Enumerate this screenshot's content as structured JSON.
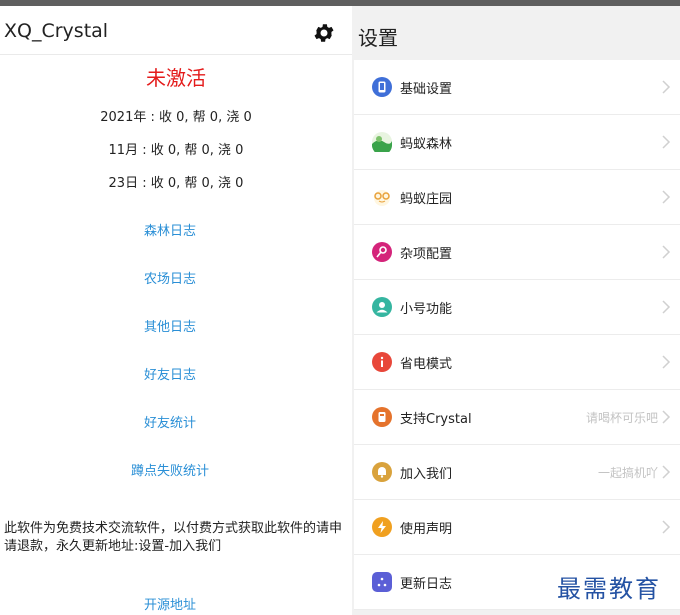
{
  "left": {
    "app_title": "XQ_Crystal",
    "status": "未激活",
    "stats": [
      "2021年 : 收 0,  帮 0,  浇 0",
      "11月 : 收 0,  帮 0,  浇 0",
      "23日 : 收 0,  帮 0,  浇 0"
    ],
    "links": [
      "森林日志",
      "农场日志",
      "其他日志",
      "好友日志",
      "好友统计",
      "蹲点失败统计"
    ],
    "notice": "此软件为免费技术交流软件，以付费方式获取此软件的请申请退款，永久更新地址:设置-加入我们",
    "open_source": "开源地址"
  },
  "right": {
    "title": "设置",
    "items": [
      {
        "label": "基础设置",
        "hint": "",
        "icon": "phone-icon"
      },
      {
        "label": "蚂蚁森林",
        "hint": "",
        "icon": "forest-icon"
      },
      {
        "label": "蚂蚁庄园",
        "hint": "",
        "icon": "farm-icon"
      },
      {
        "label": "杂项配置",
        "hint": "",
        "icon": "key-icon"
      },
      {
        "label": "小号功能",
        "hint": "",
        "icon": "user-icon"
      },
      {
        "label": "省电模式",
        "hint": "",
        "icon": "info-icon"
      },
      {
        "label": "支持Crystal",
        "hint": "请喝杯可乐吧",
        "icon": "cup-icon"
      },
      {
        "label": "加入我们",
        "hint": "一起搞机吖",
        "icon": "bell-icon"
      },
      {
        "label": "使用声明",
        "hint": "",
        "icon": "bolt-icon"
      },
      {
        "label": "更新日志",
        "hint": "",
        "icon": "dots-icon"
      }
    ]
  },
  "watermark": "最需教育",
  "colors": {
    "status_red": "#e41b1b",
    "link_blue": "#2a8fd6",
    "watermark_blue": "#2452a3"
  }
}
